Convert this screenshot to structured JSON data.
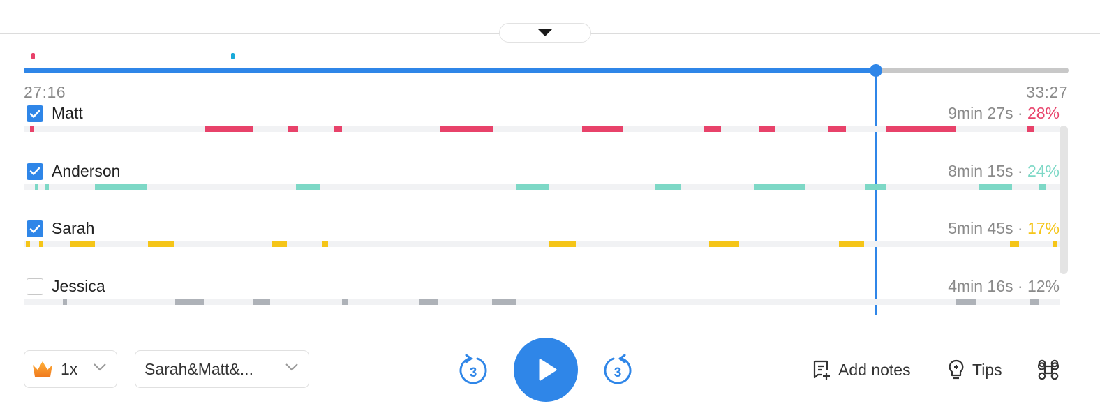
{
  "timeline": {
    "start_time": "27:16",
    "end_time": "33:27",
    "progress": 0.8156,
    "markers": [
      {
        "position": 0.005,
        "color": "#e8426a"
      },
      {
        "position": 0.196,
        "color": "#1aaad9"
      }
    ]
  },
  "speakers": [
    {
      "name": "Matt",
      "checked": true,
      "duration": "9min 27s · ",
      "percent": "28%",
      "color": "#e8426a",
      "segments": [
        [
          0.006,
          0.01
        ],
        [
          0.175,
          0.222
        ],
        [
          0.255,
          0.265
        ],
        [
          0.3,
          0.307
        ],
        [
          0.402,
          0.453
        ],
        [
          0.539,
          0.579
        ],
        [
          0.656,
          0.673
        ],
        [
          0.71,
          0.725
        ],
        [
          0.776,
          0.794
        ],
        [
          0.832,
          0.9
        ],
        [
          0.968,
          0.976
        ]
      ]
    },
    {
      "name": "Anderson",
      "checked": true,
      "duration": "8min 15s · ",
      "percent": "24%",
      "color": "#7dd8c6",
      "segments": [
        [
          0.011,
          0.014
        ],
        [
          0.02,
          0.024
        ],
        [
          0.069,
          0.119
        ],
        [
          0.263,
          0.286
        ],
        [
          0.475,
          0.507
        ],
        [
          0.609,
          0.635
        ],
        [
          0.705,
          0.754
        ],
        [
          0.812,
          0.832
        ],
        [
          0.922,
          0.954
        ],
        [
          0.98,
          0.987
        ]
      ]
    },
    {
      "name": "Sarah",
      "checked": true,
      "duration": "5min 45s · ",
      "percent": "17%",
      "color": "#f5c518",
      "segments": [
        [
          0.002,
          0.006
        ],
        [
          0.015,
          0.019
        ],
        [
          0.045,
          0.069
        ],
        [
          0.12,
          0.145
        ],
        [
          0.239,
          0.254
        ],
        [
          0.288,
          0.294
        ],
        [
          0.507,
          0.533
        ],
        [
          0.662,
          0.691
        ],
        [
          0.787,
          0.811
        ],
        [
          0.952,
          0.961
        ],
        [
          0.993,
          0.998
        ]
      ]
    },
    {
      "name": "Jessica",
      "checked": false,
      "duration": "4min 16s · ",
      "percent": "12%",
      "color": "#aeb2b8",
      "segments": [
        [
          0.038,
          0.042
        ],
        [
          0.146,
          0.174
        ],
        [
          0.222,
          0.238
        ],
        [
          0.307,
          0.313
        ],
        [
          0.382,
          0.4
        ],
        [
          0.452,
          0.476
        ],
        [
          0.9,
          0.92
        ],
        [
          0.972,
          0.98
        ]
      ]
    }
  ],
  "controls": {
    "speed": "1x",
    "speaker_filter": "Sarah&Matt&...",
    "skip_back": "3",
    "skip_forward": "3",
    "add_notes": "Add notes",
    "tips": "Tips"
  },
  "colors": {
    "accent": "#2f86e8",
    "percent_default": "#8a8a8a"
  },
  "icons": {
    "collapse": "caret-down-icon",
    "speed": "crown-icon",
    "play": "play-icon",
    "skip_back": "rewind-3-icon",
    "skip_forward": "forward-3-icon",
    "notes": "add-note-icon",
    "tips": "lightbulb-icon",
    "shortcuts": "command-key-icon"
  }
}
